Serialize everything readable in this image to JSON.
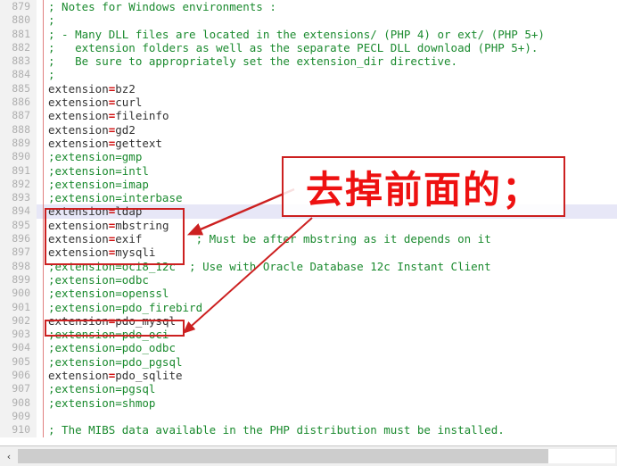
{
  "editor": {
    "first_line_number": 879,
    "current_line_number": 894,
    "lines": [
      {
        "n": "879",
        "text": "; Notes for Windows environments :",
        "type": "comment"
      },
      {
        "n": "880",
        "text": ";",
        "type": "comment"
      },
      {
        "n": "881",
        "text": "; - Many DLL files are located in the extensions/ (PHP 4) or ext/ (PHP 5+)",
        "type": "comment"
      },
      {
        "n": "882",
        "text": ";   extension folders as well as the separate PECL DLL download (PHP 5+).",
        "type": "comment"
      },
      {
        "n": "883",
        "text": ";   Be sure to appropriately set the extension_dir directive.",
        "type": "comment"
      },
      {
        "n": "884",
        "text": ";",
        "type": "comment"
      },
      {
        "n": "885",
        "key": "extension",
        "eq": "=",
        "value": "bz2",
        "type": "setting"
      },
      {
        "n": "886",
        "key": "extension",
        "eq": "=",
        "value": "curl",
        "type": "setting"
      },
      {
        "n": "887",
        "key": "extension",
        "eq": "=",
        "value": "fileinfo",
        "type": "setting"
      },
      {
        "n": "888",
        "key": "extension",
        "eq": "=",
        "value": "gd2",
        "type": "setting"
      },
      {
        "n": "889",
        "key": "extension",
        "eq": "=",
        "value": "gettext",
        "type": "setting"
      },
      {
        "n": "890",
        "text": ";extension=gmp",
        "type": "comment"
      },
      {
        "n": "891",
        "text": ";extension=intl",
        "type": "comment"
      },
      {
        "n": "892",
        "text": ";extension=imap",
        "type": "comment"
      },
      {
        "n": "893",
        "text": ";extension=interbase",
        "type": "comment"
      },
      {
        "n": "894",
        "key": "extension",
        "eq": "=",
        "value": "ldap",
        "type": "setting",
        "highlighted": true
      },
      {
        "n": "895",
        "key": "extension",
        "eq": "=",
        "value": "mbstring",
        "type": "setting"
      },
      {
        "n": "896",
        "key": "extension",
        "eq": "=",
        "value": "exif",
        "trailing_comment": "; Must be after mbstring as it depends on it",
        "type": "setting"
      },
      {
        "n": "897",
        "key": "extension",
        "eq": "=",
        "value": "mysqli",
        "type": "setting"
      },
      {
        "n": "898",
        "text": ";extension=oci8_12c  ; Use with Oracle Database 12c Instant Client",
        "type": "comment"
      },
      {
        "n": "899",
        "text": ";extension=odbc",
        "type": "comment"
      },
      {
        "n": "900",
        "text": ";extension=openssl",
        "type": "comment"
      },
      {
        "n": "901",
        "text": ";extension=pdo_firebird",
        "type": "comment"
      },
      {
        "n": "902",
        "key": "extension",
        "eq": "=",
        "value": "pdo_mysql",
        "type": "setting"
      },
      {
        "n": "903",
        "text": ";extension=pdo_oci",
        "type": "comment"
      },
      {
        "n": "904",
        "text": ";extension=pdo_odbc",
        "type": "comment"
      },
      {
        "n": "905",
        "text": ";extension=pdo_pgsql",
        "type": "comment"
      },
      {
        "n": "906",
        "key": "extension",
        "eq": "=",
        "value": "pdo_sqlite",
        "type": "setting"
      },
      {
        "n": "907",
        "text": ";extension=pgsql",
        "type": "comment"
      },
      {
        "n": "908",
        "text": ";extension=shmop",
        "type": "comment"
      },
      {
        "n": "909",
        "text": "",
        "type": "blank"
      },
      {
        "n": "910",
        "text": "; The MIBS data available in the PHP distribution must be installed.",
        "type": "comment"
      }
    ]
  },
  "annotation": {
    "callout_text": "去掉前面的；",
    "box_color": "#cc2020",
    "text_color": "#ee1111",
    "highlight_box_1_lines": "894-897",
    "highlight_box_2_lines": "902"
  },
  "scrollbar": {
    "left_arrow": "‹"
  },
  "colors": {
    "comment": "#1a8a2e",
    "equals": "#d01010",
    "key": "#333333",
    "gutter_bg": "#f2f2f2",
    "gutter_text": "#b0b0b0",
    "current_line": "#e7e7f7",
    "annotation_red": "#cc2020"
  }
}
